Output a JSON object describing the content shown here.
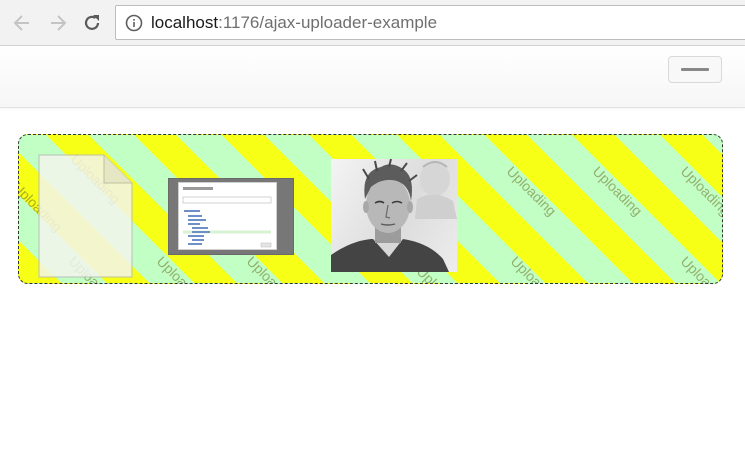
{
  "browser": {
    "url_host": "localhost",
    "url_path": ":1176/ajax-uploader-example",
    "icons": [
      "back-arrow-icon",
      "forward-arrow-icon",
      "reload-icon",
      "info-icon"
    ]
  },
  "navbar": {
    "menu_icon": "hamburger-menu-icon"
  },
  "uploader": {
    "status_watermark": "Uploading",
    "colors": {
      "stripe_yellow": "#f7ff16",
      "stripe_green": "#c2ffc4",
      "border": "#333333"
    },
    "items": [
      {
        "kind": "file",
        "icon": "generic-file-icon"
      },
      {
        "kind": "image",
        "description_icon": "screenshot-thumbnail"
      },
      {
        "kind": "image",
        "description_icon": "portrait-photo-thumbnail"
      }
    ]
  }
}
